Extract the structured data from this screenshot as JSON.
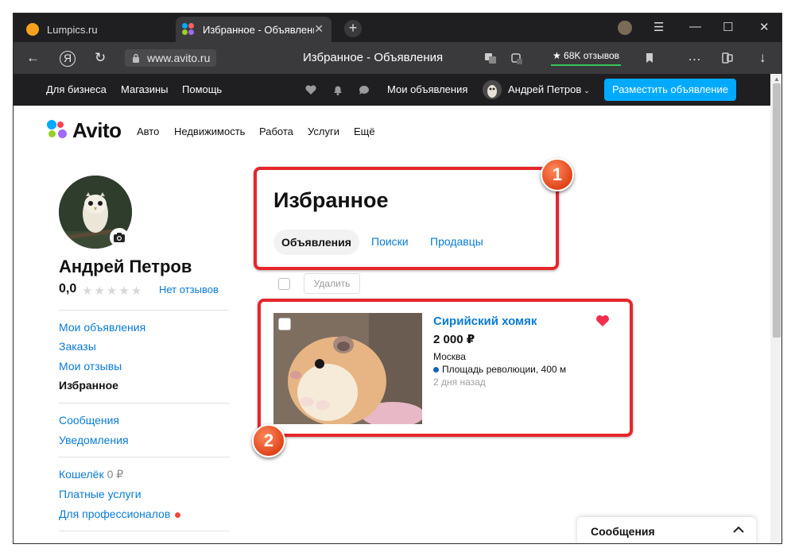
{
  "browser": {
    "tabs": [
      {
        "title": "Lumpics.ru"
      },
      {
        "title": "Избранное - Объявления"
      }
    ],
    "address": "www.avito.ru",
    "page_title": "Избранное - Объявления",
    "reviews_badge": "★ 68K отзывов",
    "tab_close": "✕",
    "new_tab": "+",
    "window_controls": {
      "menu": "☰",
      "minimize": "—",
      "maximize": "☐",
      "close": "✕"
    },
    "nav": {
      "back": "←",
      "yandex": "Я",
      "reload": "↻",
      "more": "…",
      "download": "↓"
    }
  },
  "site_header": {
    "links": [
      "Для бизнеса",
      "Магазины",
      "Помощь"
    ],
    "my_ads": "Мои объявления",
    "user": "Андрей Петров",
    "post_button": "Разместить объявление"
  },
  "avito": {
    "logo": "Avito",
    "nav": [
      "Авто",
      "Недвижимость",
      "Работа",
      "Услуги",
      "Ещё"
    ]
  },
  "profile": {
    "name": "Андрей Петров",
    "rating": "0,0",
    "stars": "★★★★★",
    "reviews_link": "Нет отзывов",
    "menu_group1": [
      "Мои объявления",
      "Заказы",
      "Мои отзывы",
      "Избранное"
    ],
    "menu_group2": [
      "Сообщения",
      "Уведомления"
    ],
    "wallet_label": "Кошелёк",
    "wallet_value": "0 ₽",
    "menu_group3": [
      "Платные услуги",
      "Для профессионалов"
    ]
  },
  "favorites": {
    "title": "Избранное",
    "tabs": [
      "Объявления",
      "Поиски",
      "Продавцы"
    ],
    "delete_button": "Удалить",
    "item": {
      "title": "Сирийский хомяк",
      "price": "2 000 ₽",
      "city": "Москва",
      "metro": "Площадь революции, 400 м",
      "date": "2 дня назад"
    }
  },
  "annotations": [
    "1",
    "2"
  ],
  "messages_widget": {
    "label": "Сообщения"
  },
  "colors": {
    "accent": "#00aaff",
    "link": "#0a7bd6",
    "annotation": "#e5262b",
    "heart": "#f0304a",
    "dark_bar": "#1f1f22"
  }
}
